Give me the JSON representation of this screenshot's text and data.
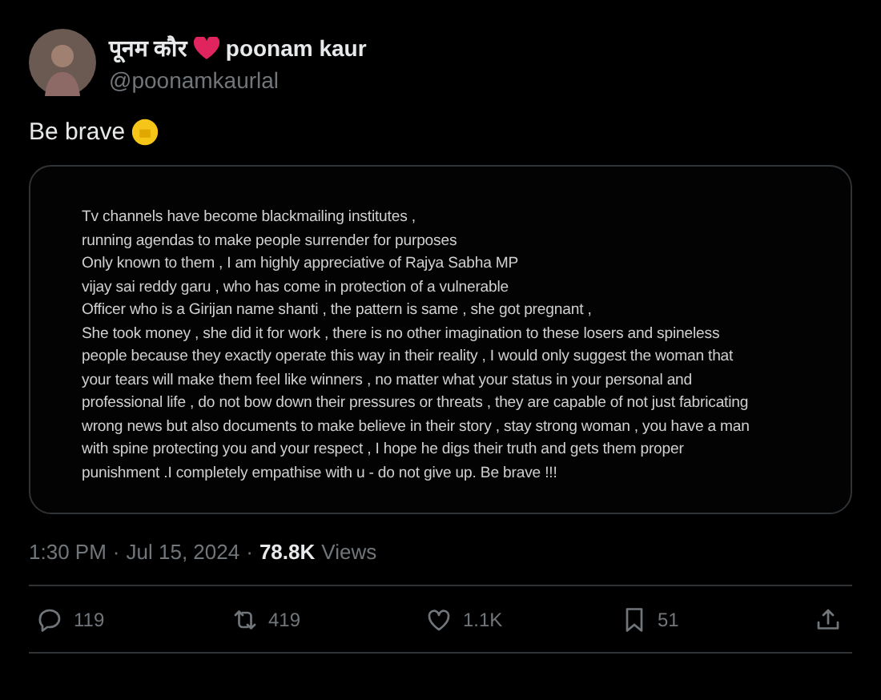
{
  "author": {
    "display_name": "पूनम कौर",
    "name_suffix": "poonam kaur",
    "handle": "@poonamkaurlal"
  },
  "post_text": "Be brave",
  "attached_note": {
    "lines": [
      "Tv channels have become blackmailing institutes ,",
      "running agendas to make people surrender for purposes",
      "Only known to them , I am highly appreciative of Rajya Sabha MP",
      "vijay sai reddy garu , who has come in protection of a vulnerable",
      "Officer who is a Girijan name shanti , the pattern is same , she got pregnant ,",
      "She took money , she did it for work , there is no other imagination to these losers and spineless",
      "people because they exactly operate this way in their reality , I would only suggest the woman that",
      "your tears will make them feel like winners , no matter what your status in your personal and",
      "professional life , do not bow down their pressures or threats , they are capable of not just fabricating",
      "wrong news but also documents to make believe in their story , stay strong woman , you have a man",
      "with spine protecting you and your respect , I hope he digs their truth and gets them proper",
      "punishment .I completely empathise with u - do not give up.  Be brave !!!"
    ]
  },
  "meta": {
    "time": "1:30 PM",
    "separator_1": "·",
    "date": "Jul 15, 2024",
    "separator_2": "·",
    "views_count": "78.8K",
    "views_label": "Views"
  },
  "actions": [
    {
      "kind": "reply",
      "count": "119"
    },
    {
      "kind": "repost",
      "count": "419"
    },
    {
      "kind": "like",
      "count": "1.1K"
    },
    {
      "kind": "bookmark",
      "count": "51"
    },
    {
      "kind": "share"
    }
  ]
}
